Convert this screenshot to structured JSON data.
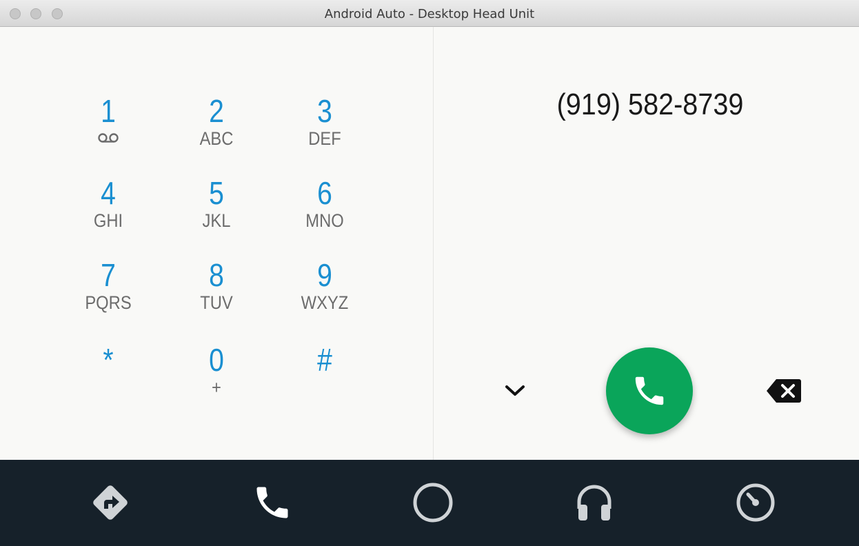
{
  "window": {
    "title": "Android Auto - Desktop Head Unit"
  },
  "dialpad": {
    "keys": [
      {
        "digit": "1",
        "letters": ""
      },
      {
        "digit": "2",
        "letters": "ABC"
      },
      {
        "digit": "3",
        "letters": "DEF"
      },
      {
        "digit": "4",
        "letters": "GHI"
      },
      {
        "digit": "5",
        "letters": "JKL"
      },
      {
        "digit": "6",
        "letters": "MNO"
      },
      {
        "digit": "7",
        "letters": "PQRS"
      },
      {
        "digit": "8",
        "letters": "TUV"
      },
      {
        "digit": "9",
        "letters": "WXYZ"
      },
      {
        "digit": "*",
        "letters": ""
      },
      {
        "digit": "0",
        "letters": "+"
      },
      {
        "digit": "#",
        "letters": ""
      }
    ]
  },
  "dialed_number": "(919) 582-8739",
  "icons": {
    "voicemail": "voicemail-icon",
    "collapse": "chevron-down-icon",
    "call": "phone-icon",
    "backspace": "backspace-icon",
    "nav": [
      "navigation-icon",
      "phone-icon",
      "home-circle-icon",
      "headphones-icon",
      "speedometer-icon"
    ]
  },
  "colors": {
    "accent_blue": "#1a8fd1",
    "call_green": "#0aa55a",
    "navbar_bg": "#16212a",
    "nav_icon": "#cfd3d6"
  }
}
